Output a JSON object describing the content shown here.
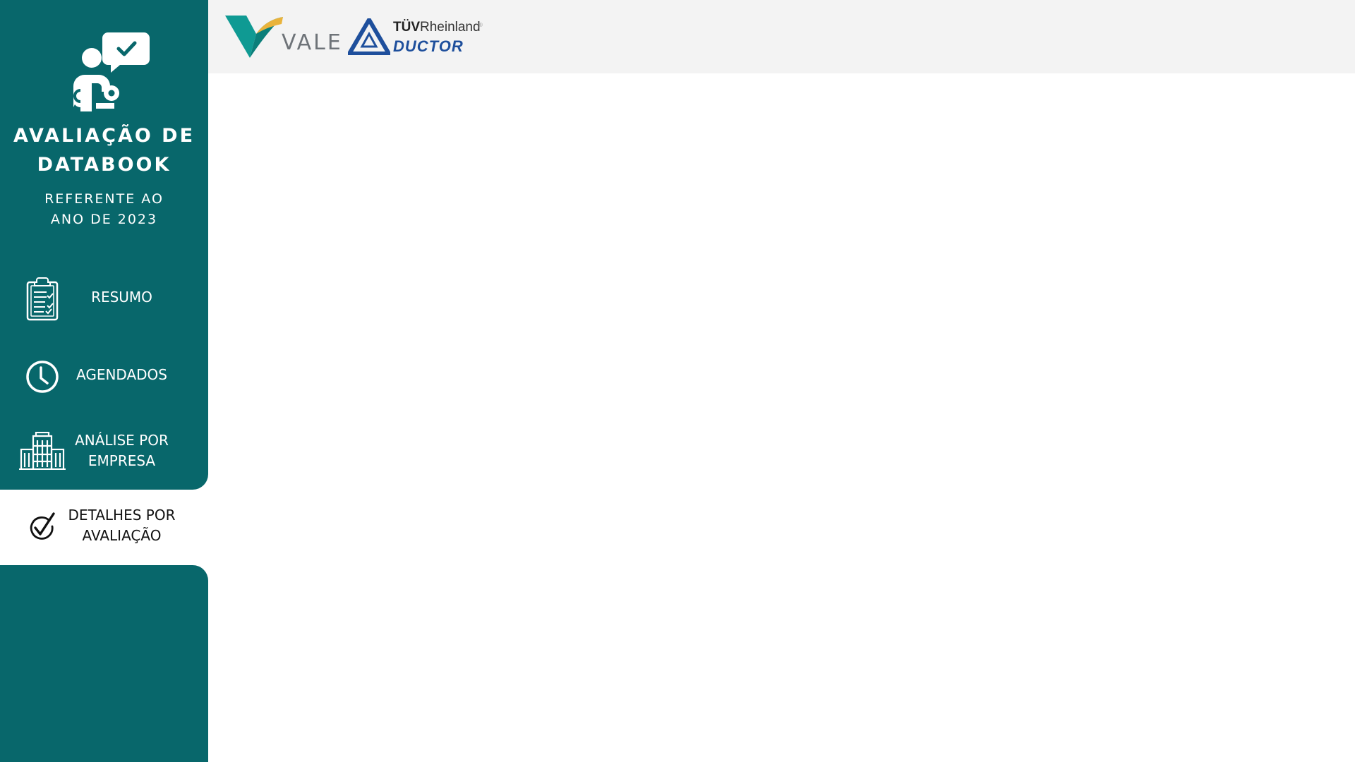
{
  "app": {
    "title_line1": "AVALIAÇÃO DE",
    "title_line2": "DATABOOK",
    "subtitle_line1": "REFERENTE AO",
    "subtitle_line2": "ANO DE 2023",
    "hero_icon": "person-chat-check-icon"
  },
  "header": {
    "logo_vale_text": "VALE",
    "logo_tuv_brand": "TÜV",
    "logo_tuv_name": "Rheinland",
    "logo_tuv_reg": "®",
    "logo_tuv_sub": "DUCTOR"
  },
  "nav": {
    "items": [
      {
        "id": "resumo",
        "line1": "RESUMO",
        "line2": "",
        "icon": "clipboard-checklist-icon",
        "active": false
      },
      {
        "id": "agendados",
        "line1": "AGENDADOS",
        "line2": "",
        "icon": "clock-icon",
        "active": false
      },
      {
        "id": "analise",
        "line1": "ANÁLISE POR",
        "line2": "EMPRESA",
        "icon": "buildings-icon",
        "active": false
      },
      {
        "id": "detalhes",
        "line1": "DETALHES POR",
        "line2": "AVALIAÇÃO",
        "icon": "check-circle-icon",
        "active": true
      }
    ]
  },
  "colors": {
    "sidebar_bg": "#08676b",
    "header_bg": "#f3f3f3",
    "active_item_bg": "#ffffff",
    "vale_teal": "#0f9a93",
    "vale_yellow": "#e9b33b",
    "tuv_blue": "#1e4f9c"
  }
}
